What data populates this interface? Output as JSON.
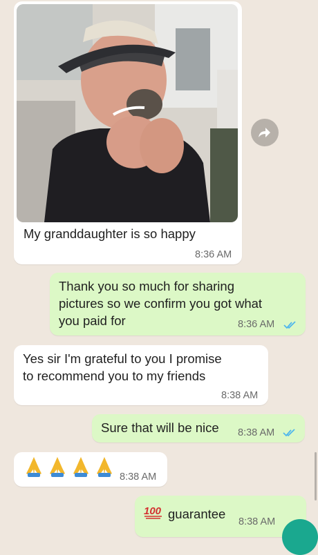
{
  "colors": {
    "chat_background": "#efe7de",
    "incoming_bubble": "#ffffff",
    "outgoing_bubble": "#dcf8c6",
    "read_ticks": "#4fb6ec",
    "fab": "#1aa88f"
  },
  "messages": [
    {
      "id": "m1",
      "direction": "incoming",
      "type": "image",
      "caption": "My granddaughter is so happy",
      "time": "8:36 AM",
      "image_description": "woman in visor holding a small hedgehog"
    },
    {
      "id": "m2",
      "direction": "outgoing",
      "text_lines": [
        "Thank you so much for sharing",
        "pictures so we confirm you got what",
        "you paid for"
      ],
      "time": "8:36 AM",
      "status": "read"
    },
    {
      "id": "m3",
      "direction": "incoming",
      "text_lines": [
        "Yes sir I'm grateful to you  I promise",
        "to recommend you to my friends"
      ],
      "time": "8:38 AM"
    },
    {
      "id": "m4",
      "direction": "outgoing",
      "text": "Sure that will be nice",
      "time": "8:38 AM",
      "status": "read"
    },
    {
      "id": "m5",
      "direction": "incoming",
      "emojis": [
        "folded-hands",
        "folded-hands",
        "folded-hands",
        "folded-hands"
      ],
      "time": "8:38 AM"
    },
    {
      "id": "m6",
      "direction": "outgoing",
      "emoji": "hundred-points",
      "text": "guarantee",
      "time": "8:38 AM",
      "status": "read"
    }
  ],
  "icons": {
    "forward": "forward-arrow-icon",
    "read_receipt": "double-check-icon",
    "emoji_100": "hundred-points-icon",
    "emoji_pray": "folded-hands-icon"
  }
}
